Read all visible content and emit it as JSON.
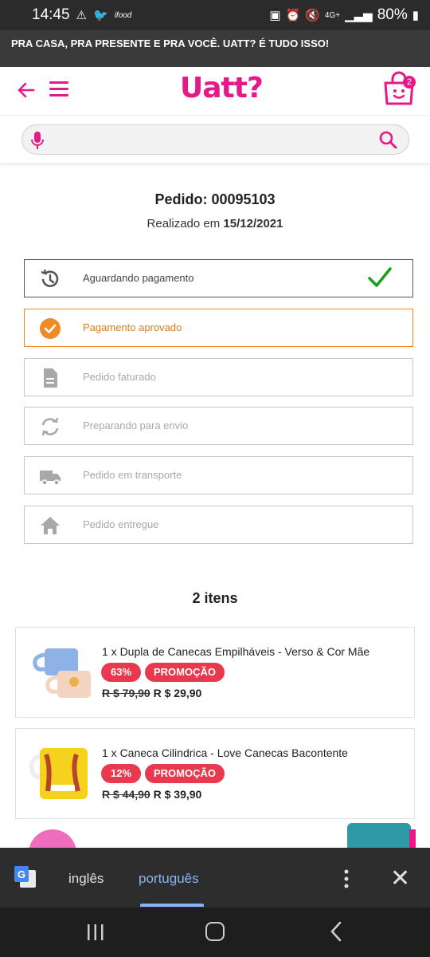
{
  "status_bar": {
    "time": "14:45",
    "battery": "80%",
    "network": "4G+"
  },
  "promo_banner": {
    "text": "PRA CASA, PRA PRESENTE E PRA VOCÊ. UATT? É TUDO ISSO!"
  },
  "header": {
    "logo": "Uatt?",
    "cart_count": "2"
  },
  "search": {
    "placeholder": ""
  },
  "order": {
    "title": "Pedido: 00095103",
    "date_prefix": "Realizado em ",
    "date": "15/12/2021"
  },
  "steps": [
    {
      "label": "Aguardando pagamento",
      "icon": "clock-history-icon"
    },
    {
      "label": "Pagamento aprovado",
      "icon": "check-circle-icon"
    },
    {
      "label": "Pedido faturado",
      "icon": "document-icon"
    },
    {
      "label": "Preparando para envio",
      "icon": "sync-icon"
    },
    {
      "label": "Pedido em transporte",
      "icon": "truck-icon"
    },
    {
      "label": "Pedido entregue",
      "icon": "home-icon"
    }
  ],
  "items_title": "2 itens",
  "items": [
    {
      "name": "1 x Dupla de Canecas Empilháveis - Verso & Cor Mãe",
      "discount": "63%",
      "tag": "PROMOÇÃO",
      "old_price": "R $ 79,90",
      "price": "R $ 29,90"
    },
    {
      "name": "1 x Caneca Cilindrica - Love Canecas Bacontente",
      "discount": "12%",
      "tag": "PROMOÇÃO",
      "old_price": "R $ 44,90",
      "price": "R $ 39,90"
    }
  ],
  "translate_bar": {
    "source_lang": "inglês",
    "target_lang": "português"
  },
  "colors": {
    "brand": "#e6198a",
    "approved": "#f08a24",
    "check": "#1a9e1a",
    "badge": "#e8394f"
  }
}
